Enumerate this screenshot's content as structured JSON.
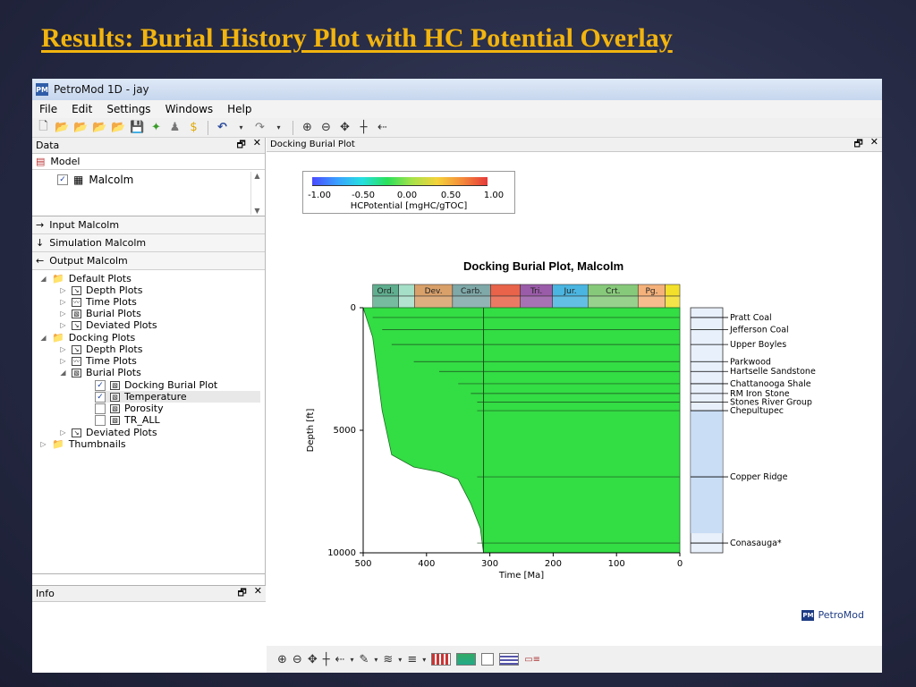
{
  "slide": {
    "title": "Results: Burial History Plot with HC Potential Overlay"
  },
  "window": {
    "title": "PetroMod 1D - jay",
    "icon_text": "PM"
  },
  "menu": [
    "File",
    "Edit",
    "Settings",
    "Windows",
    "Help"
  ],
  "data_panel": {
    "header": "Data",
    "model_label": "Model",
    "model_item": "Malcolm",
    "rows": [
      {
        "icon": "→",
        "label": "Input Malcolm"
      },
      {
        "icon": "↓",
        "label": "Simulation Malcolm"
      },
      {
        "icon": "←",
        "label": "Output Malcolm"
      }
    ],
    "tree": {
      "default_plots": "Default Plots",
      "depth_plots": "Depth Plots",
      "time_plots": "Time Plots",
      "burial_plots": "Burial Plots",
      "deviated_plots": "Deviated Plots",
      "docking_plots": "Docking Plots",
      "d_depth_plots": "Depth Plots",
      "d_time_plots": "Time Plots",
      "d_burial_plots": "Burial Plots",
      "docking_burial_plot": "Docking Burial Plot",
      "temperature": "Temperature",
      "porosity": "Porosity",
      "tr_all": "TR_ALL",
      "d_deviated_plots": "Deviated Plots",
      "thumbnails": "Thumbnails"
    }
  },
  "info_panel": {
    "header": "Info"
  },
  "main_panel": {
    "header": "Docking Burial Plot"
  },
  "legend": {
    "ticks": [
      "-1.00",
      "-0.50",
      "0.00",
      "0.50",
      "1.00"
    ],
    "caption": "HCPotential [mgHC/gTOC]"
  },
  "chart_data": {
    "type": "area",
    "title": "Docking Burial Plot, Malcolm",
    "xlabel": "Time [Ma]",
    "ylabel": "Depth [ft]",
    "xlim": [
      500,
      0
    ],
    "ylim": [
      0,
      10000
    ],
    "x_ticks": [
      "500",
      "400",
      "300",
      "200",
      "100",
      "0"
    ],
    "y_ticks": [
      "0",
      "5000",
      "10000"
    ],
    "periods": [
      {
        "label": "Ord.",
        "start": 485,
        "end": 444,
        "color": "#5fae8f"
      },
      {
        "label": "",
        "start": 444,
        "end": 419,
        "color": "#a6dfc8"
      },
      {
        "label": "Dev.",
        "start": 419,
        "end": 359,
        "color": "#d9a06a"
      },
      {
        "label": "Carb.",
        "start": 359,
        "end": 299,
        "color": "#7fa8a8"
      },
      {
        "label": "",
        "start": 299,
        "end": 252,
        "color": "#e8634a"
      },
      {
        "label": "Tri.",
        "start": 252,
        "end": 201,
        "color": "#9a5ba8"
      },
      {
        "label": "Jur.",
        "start": 201,
        "end": 145,
        "color": "#4ab5e0"
      },
      {
        "label": "Crt.",
        "start": 145,
        "end": 66,
        "color": "#87c97a"
      },
      {
        "label": "Pg.",
        "start": 66,
        "end": 23,
        "color": "#f5b17a"
      },
      {
        "label": "",
        "start": 23,
        "end": 0,
        "color": "#f3e02a"
      }
    ],
    "hc_potential_fill_color": "#33dd44",
    "burial_envelope": [
      {
        "time": 500,
        "depth": 0
      },
      {
        "time": 485,
        "depth": 1200
      },
      {
        "time": 470,
        "depth": 4200
      },
      {
        "time": 455,
        "depth": 6000
      },
      {
        "time": 420,
        "depth": 6500
      },
      {
        "time": 380,
        "depth": 6700
      },
      {
        "time": 350,
        "depth": 7000
      },
      {
        "time": 330,
        "depth": 8000
      },
      {
        "time": 315,
        "depth": 9000
      },
      {
        "time": 310,
        "depth": 10000
      },
      {
        "time": 0,
        "depth": 10000
      }
    ],
    "formations": [
      {
        "name": "Pratt Coal",
        "depth": 400
      },
      {
        "name": "Jefferson Coal",
        "depth": 900
      },
      {
        "name": "Upper Boyles",
        "depth": 1500
      },
      {
        "name": "Parkwood",
        "depth": 2200
      },
      {
        "name": "Hartselle Sandstone",
        "depth": 2600
      },
      {
        "name": "Chattanooga Shale",
        "depth": 3100
      },
      {
        "name": "RM Iron Stone",
        "depth": 3500
      },
      {
        "name": "Stones River Group",
        "depth": 3850
      },
      {
        "name": "Chepultupec",
        "depth": 4200
      },
      {
        "name": "Copper Ridge",
        "depth": 6900
      },
      {
        "name": "Conasauga*",
        "depth": 9600
      }
    ]
  },
  "branding": {
    "logo_text": "PetroMod",
    "logo_icon": "PM"
  },
  "colors": {
    "slide_title": "#f2b40f",
    "fill": "#33dd44"
  }
}
